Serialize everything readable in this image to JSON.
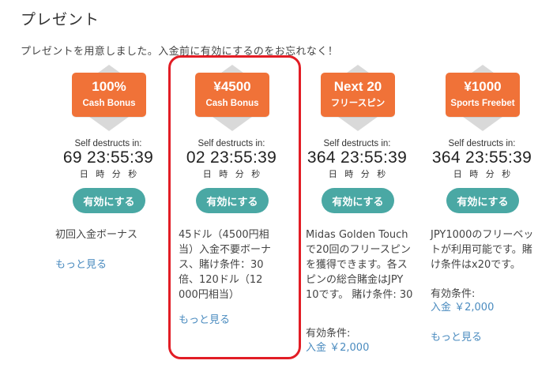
{
  "page": {
    "title": "プレゼント",
    "subtitle": "プレゼントを用意しました。入金前に有効にするのをお忘れなく！"
  },
  "colors": {
    "badge": "#f07238",
    "button": "#4aa8a4",
    "link": "#4a8bbf",
    "highlight": "#e21d25"
  },
  "offers": [
    {
      "badge_main": "100%",
      "badge_sub": "Cash Bonus",
      "timer_label": "Self destructs in:",
      "countdown": "69 23:55:39",
      "units": "日 時 分 秒",
      "button": "有効にする",
      "description": "初回入金ボーナス",
      "more": "もっと見る"
    },
    {
      "badge_main": "¥4500",
      "badge_sub": "Cash Bonus",
      "timer_label": "Self destructs in:",
      "countdown": "02 23:55:39",
      "units": "日 時 分 秒",
      "button": "有効にする",
      "description": "45ドル（4500円相当）入金不要ボーナス、賭け条件：30倍、120ドル（12 000円相当）",
      "more": "もっと見る"
    },
    {
      "badge_main": "Next 20",
      "badge_sub": "フリースピン",
      "timer_label": "Self destructs in:",
      "countdown": "364 23:55:39",
      "units": "日 時 分 秒",
      "button": "有効にする",
      "description": "Midas Golden Touchで20回のフリースピンを獲得できます。各スピンの総合賭金はJPY 10です。 賭け条件: 30",
      "condition_label": "有効条件:",
      "condition_value": "入金 ￥2,000"
    },
    {
      "badge_main": "¥1000",
      "badge_sub": "Sports Freebet",
      "timer_label": "Self destructs in:",
      "countdown": "364 23:55:39",
      "units": "日 時 分 秒",
      "button": "有効にする",
      "description": "JPY1000のフリーベットが利用可能です。賭け条件はx20です。",
      "condition_label": "有効条件:",
      "condition_value": "入金 ￥2,000",
      "more": "もっと見る"
    }
  ]
}
